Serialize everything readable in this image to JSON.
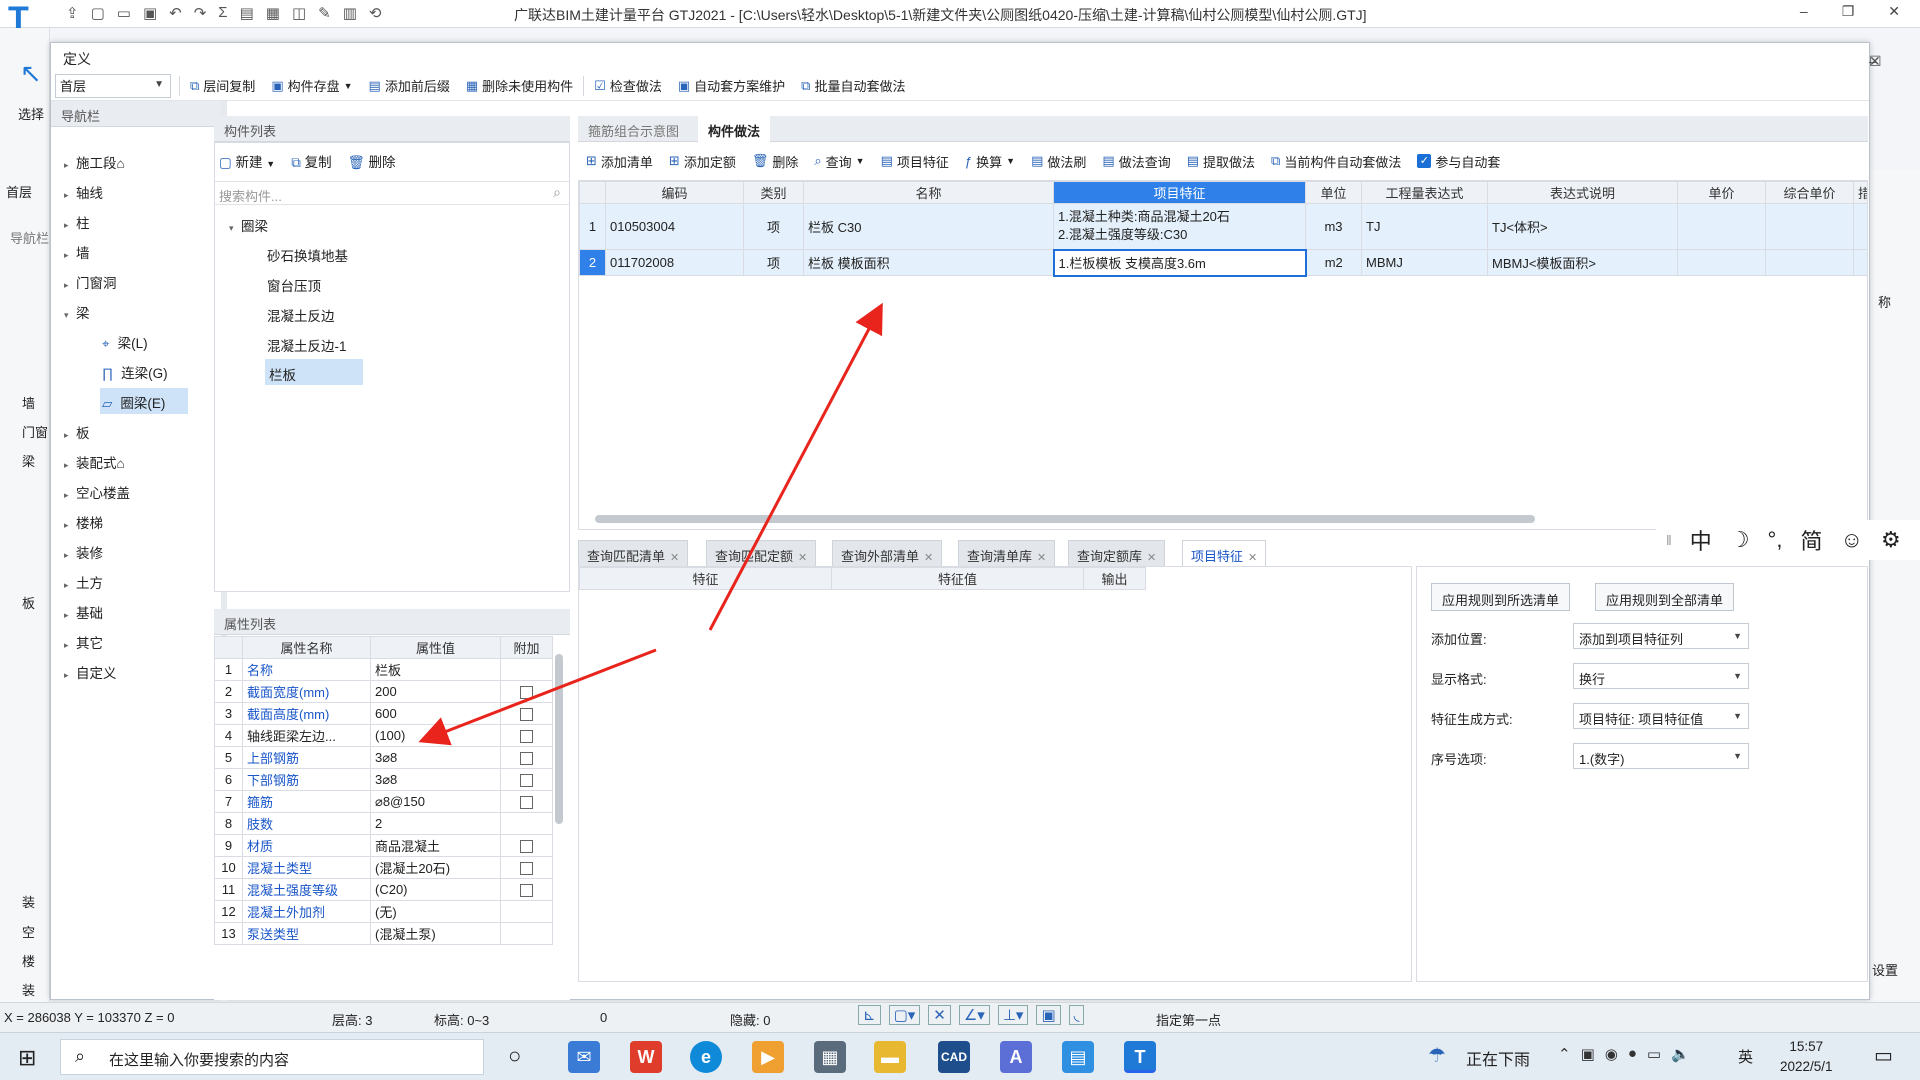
{
  "app": {
    "title": "广联达BIM土建计量平台 GTJ2021 - [C:\\Users\\轻水\\Desktop\\5-1\\新建文件夹\\公厕图纸0420-压缩\\土建-计算稿\\仙村公厕模型\\仙村公厕.GTJ]",
    "select_label": "选择",
    "left_floor": "首层",
    "left_nav": "导航栏",
    "left_items": [
      "墙",
      "门窗",
      "梁",
      "板",
      "装",
      "空",
      "楼",
      "装"
    ],
    "right_label": "称",
    "right_settings": "设置"
  },
  "dialog": {
    "title": "定义",
    "floor": "首层",
    "toolbar": [
      "层间复制",
      "构件存盘",
      "添加前后缀",
      "删除未使用构件",
      "检查做法",
      "自动套方案维护",
      "批量自动套做法"
    ]
  },
  "nav": {
    "header": "导航栏",
    "items": [
      "施工段⌂",
      "轴线",
      "柱",
      "墙",
      "门窗洞",
      "梁",
      "板",
      "装配式⌂",
      "空心楼盖",
      "楼梯",
      "装修",
      "土方",
      "基础",
      "其它",
      "自定义"
    ],
    "beam_children": [
      "梁(L)",
      "连梁(G)",
      "圈梁(E)"
    ]
  },
  "components": {
    "header": "构件列表",
    "new": "新建",
    "copy": "复制",
    "delete": "删除",
    "search_placeholder": "搜索构件...",
    "group": "圈梁",
    "items": [
      "砂石换填地基",
      "窗台压顶",
      "混凝土反边",
      "混凝土反边-1",
      "栏板"
    ],
    "selected": "栏板"
  },
  "properties": {
    "header": "属性列表",
    "columns": [
      "属性名称",
      "属性值",
      "附加"
    ],
    "rows": [
      {
        "no": "1",
        "name": "名称",
        "value": "栏板",
        "blue": true,
        "check": false
      },
      {
        "no": "2",
        "name": "截面宽度(mm)",
        "value": "200",
        "blue": true,
        "check": true
      },
      {
        "no": "3",
        "name": "截面高度(mm)",
        "value": "600",
        "blue": true,
        "check": true
      },
      {
        "no": "4",
        "name": "轴线距梁左边...",
        "value": "(100)",
        "blue": false,
        "check": true
      },
      {
        "no": "5",
        "name": "上部钢筋",
        "value": "3⌀8",
        "blue": true,
        "check": true
      },
      {
        "no": "6",
        "name": "下部钢筋",
        "value": "3⌀8",
        "blue": true,
        "check": true
      },
      {
        "no": "7",
        "name": "箍筋",
        "value": "⌀8@150",
        "blue": true,
        "check": true
      },
      {
        "no": "8",
        "name": "肢数",
        "value": "2",
        "blue": true,
        "check": false
      },
      {
        "no": "9",
        "name": "材质",
        "value": "商品混凝土",
        "blue": true,
        "check": true
      },
      {
        "no": "10",
        "name": "混凝土类型",
        "value": "(混凝土20石)",
        "blue": true,
        "check": true
      },
      {
        "no": "11",
        "name": "混凝土强度等级",
        "value": "(C20)",
        "blue": true,
        "check": true
      },
      {
        "no": "12",
        "name": "混凝土外加剂",
        "value": "(无)",
        "blue": true,
        "check": false
      },
      {
        "no": "13",
        "name": "泵送类型",
        "value": "(混凝土泵)",
        "blue": true,
        "check": false
      }
    ]
  },
  "method": {
    "tabs": [
      "箍筋组合示意图",
      "构件做法"
    ],
    "toolbar": [
      "添加清单",
      "添加定额",
      "删除",
      "查询",
      "项目特征",
      "换算",
      "做法刷",
      "做法查询",
      "提取做法",
      "当前构件自动套做法",
      "参与自动套"
    ],
    "columns": [
      "编码",
      "类别",
      "名称",
      "项目特征",
      "单位",
      "工程量表达式",
      "表达式说明",
      "单价",
      "综合单价",
      "措"
    ],
    "rows": [
      {
        "no": "1",
        "code": "010503004",
        "type": "项",
        "name": "栏板 C30",
        "feature1": "1.混凝土种类:商品混凝土20石",
        "feature2": "2.混凝土强度等级:C30",
        "unit": "m3",
        "expr": "TJ",
        "desc": "TJ<体积>"
      },
      {
        "no": "2",
        "code": "011702008",
        "type": "项",
        "name": "栏板 模板面积",
        "feature1": "1.栏板模板 支模高度3.6m",
        "feature2": "",
        "unit": "m2",
        "expr": "MBMJ",
        "desc": "MBMJ<模板面积>"
      }
    ]
  },
  "bottom": {
    "tabs": [
      "查询匹配清单",
      "查询匹配定额",
      "查询外部清单",
      "查询清单库",
      "查询定额库",
      "项目特征"
    ],
    "columns": [
      "特征",
      "特征值",
      "输出"
    ],
    "btn_selected": "应用规则到所选清单",
    "btn_all": "应用规则到全部清单",
    "fields": [
      {
        "label": "添加位置:",
        "value": "添加到项目特征列"
      },
      {
        "label": "显示格式:",
        "value": "换行"
      },
      {
        "label": "特征生成方式:",
        "value": "项目特征: 项目特征值"
      },
      {
        "label": "序号选项:",
        "value": "1.(数字)"
      }
    ]
  },
  "ime": [
    "中",
    "☽",
    "°,",
    "简",
    "☺",
    "⚙"
  ],
  "status": {
    "coords": "X = 286038 Y = 103370 Z = 0",
    "floor_h": "层高:  3",
    "elev": "标高:  0~3",
    "zero": "0",
    "hidden": "隐藏:  0",
    "hint": "指定第一点"
  },
  "taskbar": {
    "search": "在这里输入你要搜索的内容",
    "weather": "正在下雨",
    "lang": "英",
    "time": "15:57",
    "date": "2022/5/1"
  },
  "colors": {
    "accent": "#1a56c9",
    "selected": "#cfe3f8",
    "arrow": "#e8241c"
  }
}
